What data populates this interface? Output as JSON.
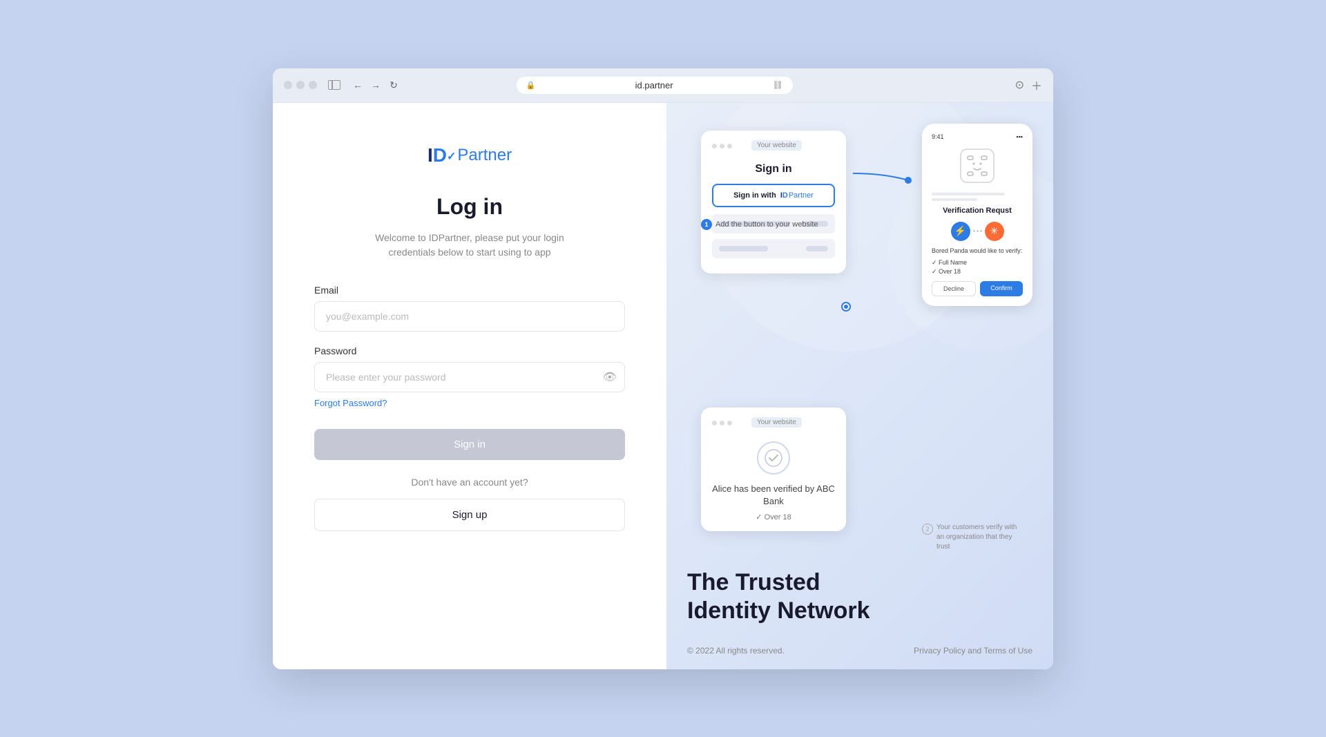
{
  "browser": {
    "url": "id.partner",
    "back_arrow": "←",
    "forward_arrow": "→",
    "reload_icon": "↻"
  },
  "login": {
    "logo_id": "ID",
    "logo_id_check": "✓",
    "logo_partner": "Partner",
    "title": "Log in",
    "subtitle": "Welcome to IDPartner, please put your login credentials below to start using to app",
    "email_label": "Email",
    "email_placeholder": "you@example.com",
    "password_label": "Password",
    "password_placeholder": "Please enter your password",
    "forgot_password": "Forgot Password?",
    "signin_button": "Sign in",
    "no_account_text": "Don't have an account yet?",
    "signup_button": "Sign up"
  },
  "right_panel": {
    "card1": {
      "tag": "Your website",
      "title": "Sign in",
      "signin_btn_text": "Sign in with",
      "logo_text": "IDPartner"
    },
    "step1_label": "Add the button to your website",
    "step2_label": "Your customers verify with an organization that they trust",
    "card_mobile": {
      "time": "9:41",
      "title": "Verification\nRequst",
      "brand_text": "Bored Panda would like\nto verify:",
      "check1": "✓ Full Name",
      "check2": "✓ Over 18",
      "decline_btn": "Decline",
      "confirm_btn": "Confirm"
    },
    "card_verified": {
      "tag": "Your website",
      "verified_text": "Alice has been verified\nby ABC Bank",
      "verified_check": "✓ Over 18"
    },
    "tagline_line1": "The Trusted",
    "tagline_line2": "Identity Network",
    "footer": {
      "copyright": "© 2022 All rights reserved.",
      "privacy": "Privacy Policy",
      "and_text": " and ",
      "terms": "Terms of Use"
    }
  }
}
